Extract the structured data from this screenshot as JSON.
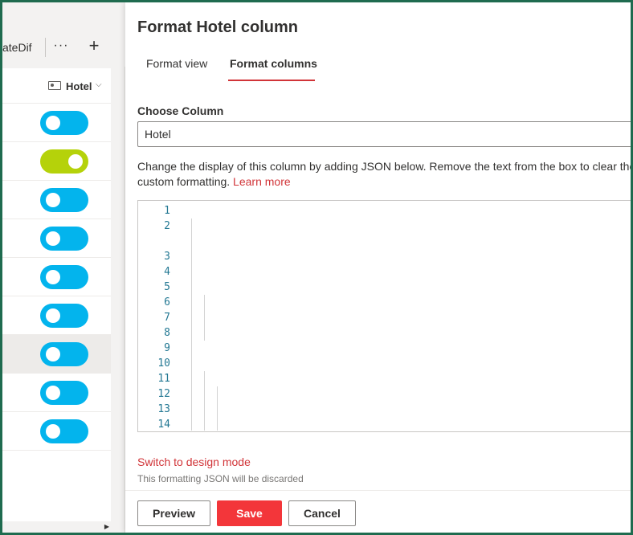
{
  "app": {
    "tab_fragment": "ateDif",
    "more_label": "···",
    "add_label": "+"
  },
  "list": {
    "column_name": "Hotel",
    "column_chevron": "⌄",
    "rows": [
      {
        "toggle": "blue"
      },
      {
        "toggle": "green"
      },
      {
        "toggle": "blue"
      },
      {
        "toggle": "blue"
      },
      {
        "toggle": "blue"
      },
      {
        "toggle": "blue"
      },
      {
        "toggle": "blue",
        "selected": true
      },
      {
        "toggle": "blue"
      },
      {
        "toggle": "blue"
      }
    ]
  },
  "panel": {
    "title": "Format Hotel column",
    "tabs": [
      {
        "label": "Format view",
        "active": false
      },
      {
        "label": "Format columns",
        "active": true
      }
    ],
    "choose_column_label": "Choose Column",
    "selected_column": "Hotel",
    "description": "Change the display of this column by adding JSON below. Remove the text from the box to clear the custom formatting.",
    "learn_more": "Learn more",
    "switch_link": "Switch to design mode",
    "discard_note": "This formatting JSON will be discarded",
    "buttons": {
      "preview": "Preview",
      "save": "Save",
      "cancel": "Cancel"
    }
  },
  "editor": {
    "line_numbers": [
      "1",
      "2",
      "",
      "3",
      "4",
      "5",
      "6",
      "7",
      "8",
      "9",
      "10",
      "11",
      "12",
      "13",
      "14"
    ]
  },
  "colors": {
    "accent": "#d13438",
    "save_button": "#f3363a",
    "toggle_blue": "#03b4ed",
    "toggle_green": "#b5d20a",
    "frame_border": "#1f6b4f"
  }
}
